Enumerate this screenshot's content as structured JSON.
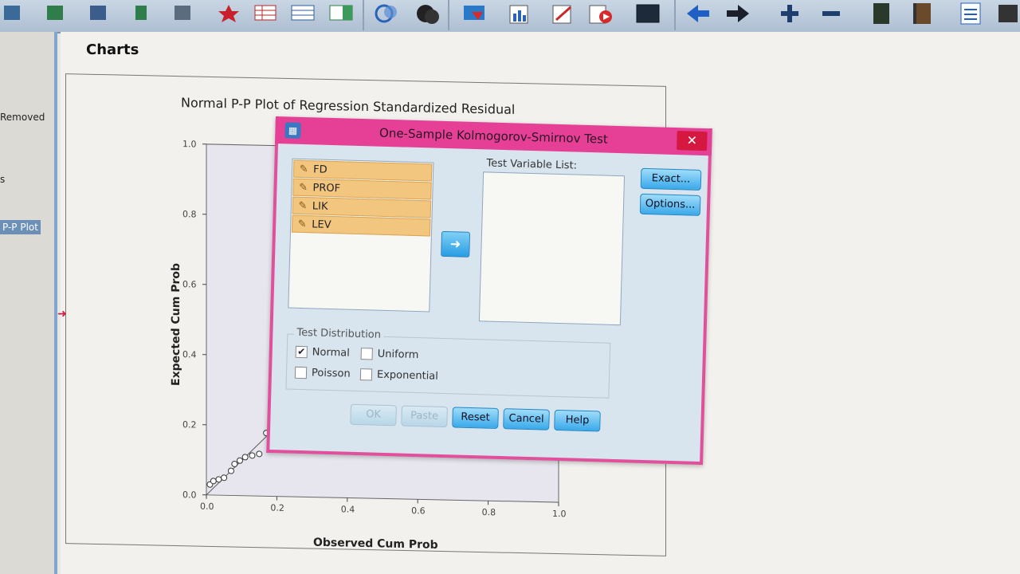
{
  "nav": {
    "items": [
      "Removed",
      "s",
      "P-P Plot"
    ]
  },
  "output": {
    "heading": "Charts"
  },
  "chart": {
    "title": "Normal P-P Plot of Regression Standardized Residual",
    "xlabel": "Observed Cum Prob",
    "ylabel": "Expected Cum Prob",
    "x_ticks": [
      "0.0",
      "0.2",
      "0.4",
      "0.6",
      "0.8",
      "1.0"
    ],
    "y_ticks": [
      "0.0",
      "0.2",
      "0.4",
      "0.6",
      "0.8",
      "1.0"
    ]
  },
  "chart_data": {
    "type": "scatter",
    "title": "Normal P-P Plot of Regression Standardized Residual",
    "xlabel": "Observed Cum Prob",
    "ylabel": "Expected Cum Prob",
    "xlim": [
      0,
      1
    ],
    "ylim": [
      0,
      1
    ],
    "x": [
      0.01,
      0.02,
      0.035,
      0.05,
      0.07,
      0.08,
      0.095,
      0.11,
      0.13,
      0.15,
      0.17,
      0.19
    ],
    "y": [
      0.03,
      0.04,
      0.045,
      0.05,
      0.07,
      0.09,
      0.1,
      0.11,
      0.115,
      0.12,
      0.18,
      0.19
    ]
  },
  "dialog": {
    "title": "One-Sample Kolmogorov-Smirnov Test",
    "close": "✕",
    "variables": [
      "FD",
      "PROF",
      "LIK",
      "LEV"
    ],
    "test_variable_label": "Test Variable List:",
    "buttons": {
      "exact": "Exact...",
      "options": "Options...",
      "ok": "OK",
      "paste": "Paste",
      "reset": "Reset",
      "cancel": "Cancel",
      "help": "Help"
    },
    "test_distribution": {
      "legend": "Test Distribution",
      "normal": "Normal",
      "uniform": "Uniform",
      "poisson": "Poisson",
      "exponential": "Exponential",
      "normal_checked": true,
      "uniform_checked": false,
      "poisson_checked": false,
      "exponential_checked": false
    }
  },
  "colors": {
    "dialog_border": "#e0509b",
    "selected_variable": "#f3c680",
    "button_blue": "#3aa9ea"
  }
}
